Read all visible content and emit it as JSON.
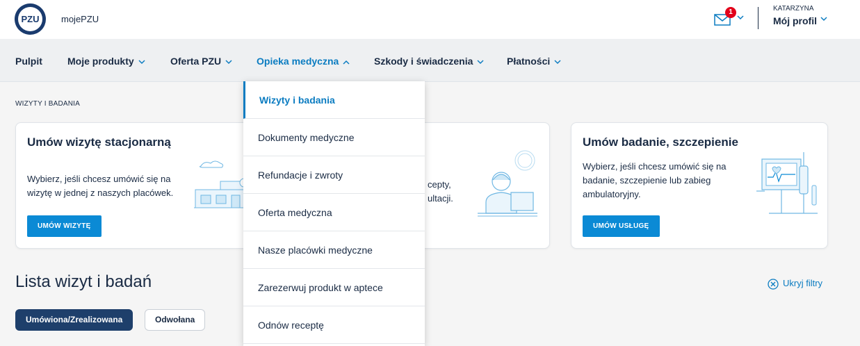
{
  "header": {
    "logo_text": "PZU",
    "brand": "mojePZU",
    "mail_count": "1",
    "user_name": "KATARZYNA",
    "profile_label": "Mój profil"
  },
  "nav": {
    "items": [
      {
        "label": "Pulpit"
      },
      {
        "label": "Moje produkty"
      },
      {
        "label": "Oferta PZU"
      },
      {
        "label": "Opieka medyczna"
      },
      {
        "label": "Szkody i świadczenia"
      },
      {
        "label": "Płatności"
      }
    ]
  },
  "breadcrumb": "WIZYTY I BADANIA",
  "cards": [
    {
      "title": "Umów wizytę stacjonarną",
      "description": "Wybierz, jeśli chcesz umówić się na wizytę w jednej z naszych placówek.",
      "button": "UMÓW WIZYTĘ"
    },
    {
      "description_fragment_1": "cepty,",
      "description_fragment_2": "ultacji."
    },
    {
      "title": "Umów badanie, szczepienie",
      "description": "Wybierz, jeśli chcesz umówić się na badanie, szczepienie lub zabieg ambulatoryjny.",
      "button": "UMÓW USŁUGĘ"
    }
  ],
  "list": {
    "title": "Lista wizyt i badań",
    "hide_filters": "Ukryj filtry",
    "chips": [
      "Umówiona/Zrealizowana",
      "Odwołana"
    ]
  },
  "dropdown": {
    "items": [
      {
        "label": "Wizyty i badania",
        "active": true
      },
      {
        "label": "Dokumenty medyczne"
      },
      {
        "label": "Refundacje i zwroty"
      },
      {
        "label": "Oferta medyczna"
      },
      {
        "label": "Nasze placówki medyczne"
      },
      {
        "label": "Zarezerwuj produkt w aptece"
      },
      {
        "label": "Odnów receptę"
      }
    ]
  },
  "colors": {
    "accent": "#0b7cc1",
    "button": "#0b8ad5",
    "navy": "#1a2b44",
    "badge": "#e2001a"
  }
}
